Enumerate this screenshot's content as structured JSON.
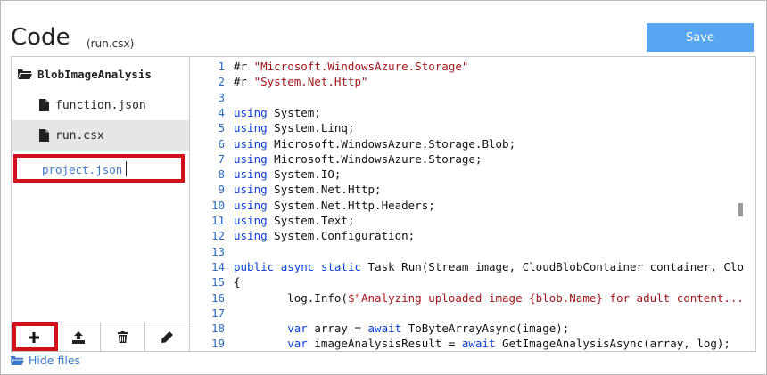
{
  "header": {
    "title": "Code",
    "subtitle": "(run.csx)",
    "save_label": "Save"
  },
  "sidebar": {
    "folder_name": "BlobImageAnalysis",
    "files": [
      {
        "name": "function.json",
        "active": false
      },
      {
        "name": "run.csx",
        "active": true
      }
    ],
    "new_file_input_value": "project.json"
  },
  "toolbar": {
    "icons": [
      "plus-icon",
      "upload-icon",
      "trash-icon",
      "pencil-icon"
    ]
  },
  "footer": {
    "hide_files_label": "Hide files"
  },
  "editor": {
    "lines": [
      {
        "n": "1",
        "tokens": [
          [
            "t",
            "#r "
          ],
          [
            "s",
            "\"Microsoft.WindowsAzure.Storage\""
          ]
        ]
      },
      {
        "n": "2",
        "tokens": [
          [
            "t",
            "#r "
          ],
          [
            "s",
            "\"System.Net.Http\""
          ]
        ]
      },
      {
        "n": "3",
        "tokens": []
      },
      {
        "n": "4",
        "tokens": [
          [
            "k",
            "using"
          ],
          [
            "t",
            " System;"
          ]
        ]
      },
      {
        "n": "5",
        "tokens": [
          [
            "k",
            "using"
          ],
          [
            "t",
            " System.Linq;"
          ]
        ]
      },
      {
        "n": "6",
        "tokens": [
          [
            "k",
            "using"
          ],
          [
            "t",
            " Microsoft.WindowsAzure.Storage.Blob;"
          ]
        ]
      },
      {
        "n": "7",
        "tokens": [
          [
            "k",
            "using"
          ],
          [
            "t",
            " Microsoft.WindowsAzure.Storage;"
          ]
        ]
      },
      {
        "n": "8",
        "tokens": [
          [
            "k",
            "using"
          ],
          [
            "t",
            " System.IO;"
          ]
        ]
      },
      {
        "n": "9",
        "tokens": [
          [
            "k",
            "using"
          ],
          [
            "t",
            " System.Net.Http;"
          ]
        ]
      },
      {
        "n": "10",
        "tokens": [
          [
            "k",
            "using"
          ],
          [
            "t",
            " System.Net.Http.Headers;"
          ]
        ]
      },
      {
        "n": "11",
        "tokens": [
          [
            "k",
            "using"
          ],
          [
            "t",
            " System.Text;"
          ]
        ]
      },
      {
        "n": "12",
        "tokens": [
          [
            "k",
            "using"
          ],
          [
            "t",
            " System.Configuration;"
          ]
        ]
      },
      {
        "n": "13",
        "tokens": []
      },
      {
        "n": "14",
        "tokens": [
          [
            "k",
            "public"
          ],
          [
            "t",
            " "
          ],
          [
            "k",
            "async"
          ],
          [
            "t",
            " "
          ],
          [
            "k",
            "static"
          ],
          [
            "t",
            " Task Run(Stream image, CloudBlobContainer container, Clo"
          ]
        ]
      },
      {
        "n": "15",
        "tokens": [
          [
            "t",
            "{"
          ]
        ]
      },
      {
        "n": "16",
        "tokens": [
          [
            "t",
            "        log.Info("
          ],
          [
            "s",
            "$\"Analyzing uploaded image {blob.Name} for adult content..."
          ]
        ]
      },
      {
        "n": "17",
        "tokens": []
      },
      {
        "n": "18",
        "tokens": [
          [
            "t",
            "        "
          ],
          [
            "k",
            "var"
          ],
          [
            "t",
            " array = "
          ],
          [
            "k",
            "await"
          ],
          [
            "t",
            " ToByteArrayAsync(image);"
          ]
        ]
      },
      {
        "n": "19",
        "tokens": [
          [
            "t",
            "        "
          ],
          [
            "k",
            "var"
          ],
          [
            "t",
            " imageAnalysisResult = "
          ],
          [
            "k",
            "await"
          ],
          [
            "t",
            " GetImageAnalysisAsync(array, log);"
          ]
        ]
      }
    ]
  }
}
